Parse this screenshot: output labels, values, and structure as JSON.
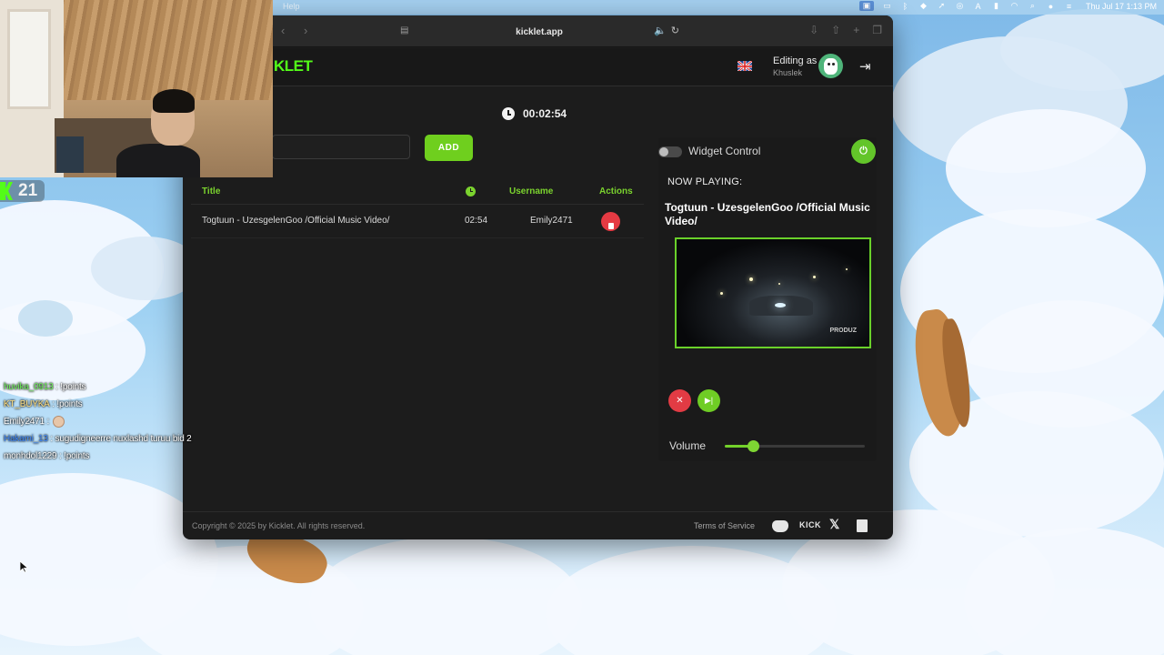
{
  "menubar": {
    "help_label": "Help",
    "clock": "Thu Jul 17  1:13 PM"
  },
  "stream_overlay": {
    "follower_count": "21",
    "chat": [
      {
        "user": "huvika_0913",
        "message": "!points"
      },
      {
        "user": "KT_BUYKA",
        "message": "!points"
      },
      {
        "user": "Emily2471",
        "message": ""
      },
      {
        "user": "Hakami_13",
        "message": "sugudigneerre nuxlashd turuu bid 2"
      },
      {
        "user": "monhdol1229",
        "message": "!points"
      }
    ]
  },
  "browser": {
    "url": "kicklet.app"
  },
  "header": {
    "logo_text": "KLET",
    "editing_label": "Editing as",
    "editing_user": "Khuslek"
  },
  "timer": {
    "total_duration": "00:02:54"
  },
  "add_form": {
    "input_value": "",
    "add_label": "ADD"
  },
  "queue": {
    "headers": {
      "title": "Title",
      "username": "Username",
      "actions": "Actions"
    },
    "rows": [
      {
        "title": "Togtuun - UzesgelenGoo /Official Music Video/",
        "duration": "02:54",
        "username": "Emily2471"
      }
    ]
  },
  "player": {
    "widget_control_label": "Widget Control",
    "widget_control_on": false,
    "now_playing_label": "NOW PLAYING:",
    "now_playing_title": "Togtuun - UzesgelenGoo /Official Music Video/",
    "video_watermark": "PRODUZ",
    "volume_label": "Volume",
    "volume_level": 0.2
  },
  "footer": {
    "copyright": "Copyright © 2025 by Kicklet. All rights reserved.",
    "terms_label": "Terms of Service",
    "kick_label": "KICK"
  },
  "colors": {
    "accent_green": "#6fcf1e",
    "danger_red": "#e53a43",
    "kick_green": "#53fc18"
  }
}
